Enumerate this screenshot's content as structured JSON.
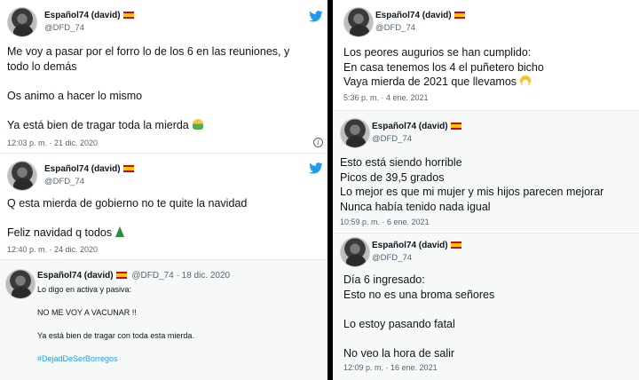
{
  "colors": {
    "twitter_blue": "#1d9bf0",
    "text": "#0f1419",
    "muted": "#536471"
  },
  "user": {
    "name": "Español74 (david)",
    "handle": "@DFD_74"
  },
  "left": {
    "t1": {
      "lines": [
        "Me voy a pasar por el forro lo de los 6 en las reuniones, y",
        "todo lo demás",
        "",
        "Os animo a hacer lo mismo",
        "",
        "Ya está bien de tragar toda la mierda"
      ],
      "time": "12:03 p. m. · 21 dic. 2020"
    },
    "t2": {
      "lines": [
        "Q esta mierda de gobierno no te quite la navidad",
        "",
        "Feliz navidad q todos"
      ],
      "time": "12:40 p. m. · 24 dic. 2020"
    },
    "t3": {
      "meta": "@DFD_74 · 18 dic. 2020",
      "lines": [
        "Lo digo en activa y pasiva:",
        "",
        "NO ME VOY A VACUNAR !!",
        "",
        "Ya está bien de tragar con toda esta mierda.",
        ""
      ],
      "hashtag": "#DejadDeSerBorregos"
    }
  },
  "right": {
    "t1": {
      "lines": [
        "Los peores augurios se han cumplido:",
        "En casa tenemos los 4 el puñetero bicho",
        "Vaya mierda de 2021 que llevamos"
      ],
      "time": "5:36 p. m. · 4 ene. 2021"
    },
    "t2": {
      "lines": [
        "Esto está siendo horrible",
        "Picos de 39,5 grados",
        "Lo mejor es que mi mujer y mis hijos parecen mejorar",
        "Nunca había tenido nada igual"
      ],
      "time": "10:59 p. m. · 6 ene. 2021"
    },
    "t3": {
      "lines": [
        "Día 6 ingresado:",
        "Esto no es una broma señores",
        "",
        "Lo estoy pasando fatal",
        "",
        "No veo la hora de salir"
      ],
      "time": "12:09 p. m. · 16 ene. 2021"
    }
  },
  "icons": {
    "bird": "twitter-bird-icon",
    "info": "info-icon",
    "flag": "spain-flag-icon"
  }
}
